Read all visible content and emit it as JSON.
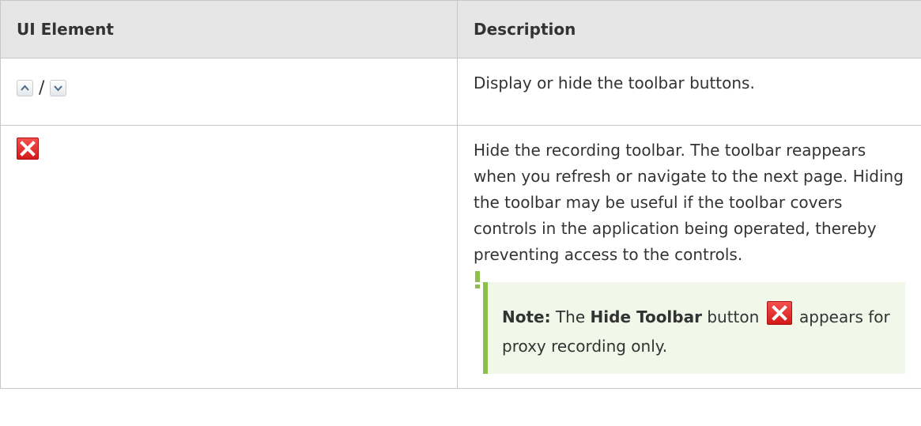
{
  "header": {
    "col1": "UI Element",
    "col2": "Description"
  },
  "rows": [
    {
      "icons": [
        "chevron-up-icon",
        "chevron-down-icon"
      ],
      "separator": "/",
      "description": "Display or hide the toolbar buttons."
    },
    {
      "icons": [
        "close-icon"
      ],
      "description": "Hide the recording toolbar. The toolbar reappears when you refresh or navigate to the next page. Hiding the toolbar may be useful if the toolbar covers controls in the application being operated, thereby preventing access to the controls.",
      "note": {
        "label": "Note:",
        "text_before": "The",
        "button_name": "Hide Toolbar",
        "text_middle": "button",
        "text_after": "appears for proxy recording only."
      }
    }
  ],
  "colors": {
    "header_bg": "#e6e6e6",
    "note_bg": "#f1f7e9",
    "note_accent": "#8cc04b",
    "close_red": "#d21a1a"
  }
}
